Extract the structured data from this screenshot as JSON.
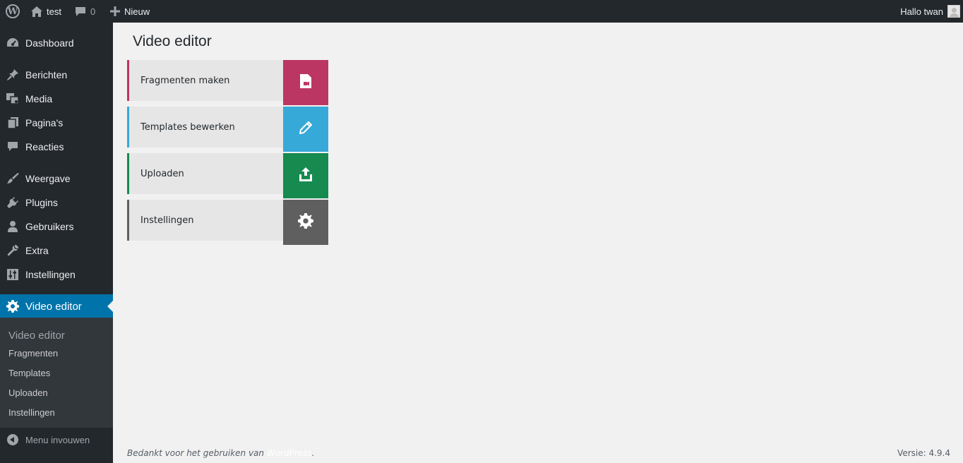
{
  "adminbar": {
    "site_name": "test",
    "comments_count": "0",
    "new_label": "Nieuw",
    "greeting": "Hallo twan"
  },
  "sidebar": {
    "items": [
      {
        "label": "Dashboard",
        "icon": "dashboard-icon"
      },
      {
        "label": "Berichten",
        "icon": "pin-icon"
      },
      {
        "label": "Media",
        "icon": "media-icon"
      },
      {
        "label": "Pagina's",
        "icon": "page-icon"
      },
      {
        "label": "Reacties",
        "icon": "comment-icon"
      },
      {
        "label": "Weergave",
        "icon": "brush-icon"
      },
      {
        "label": "Plugins",
        "icon": "plugin-icon"
      },
      {
        "label": "Gebruikers",
        "icon": "user-icon"
      },
      {
        "label": "Extra",
        "icon": "wrench-icon"
      },
      {
        "label": "Instellingen",
        "icon": "settings-sliders-icon"
      },
      {
        "label": "Video editor",
        "icon": "gear-icon",
        "current": true
      }
    ],
    "submenu": {
      "title": "Video editor",
      "items": [
        "Fragmenten",
        "Templates",
        "Uploaden",
        "Instellingen"
      ]
    },
    "collapse_label": "Menu invouwen"
  },
  "main": {
    "title": "Video editor",
    "tiles": [
      {
        "label": "Fragmenten maken",
        "color": "#bc3664",
        "icon": "video-file-icon"
      },
      {
        "label": "Templates bewerken",
        "color": "#36a9d9",
        "icon": "pencil-icon"
      },
      {
        "label": "Uploaden",
        "color": "#168a4f",
        "icon": "upload-icon"
      },
      {
        "label": "Instellingen",
        "color": "#5f5f5f",
        "icon": "gear-icon"
      }
    ]
  },
  "footer": {
    "thanks_prefix": "Bedankt voor het gebruiken van ",
    "thanks_link": "WordPress",
    "thanks_suffix": ".",
    "version": "Versie: 4.9.4"
  }
}
